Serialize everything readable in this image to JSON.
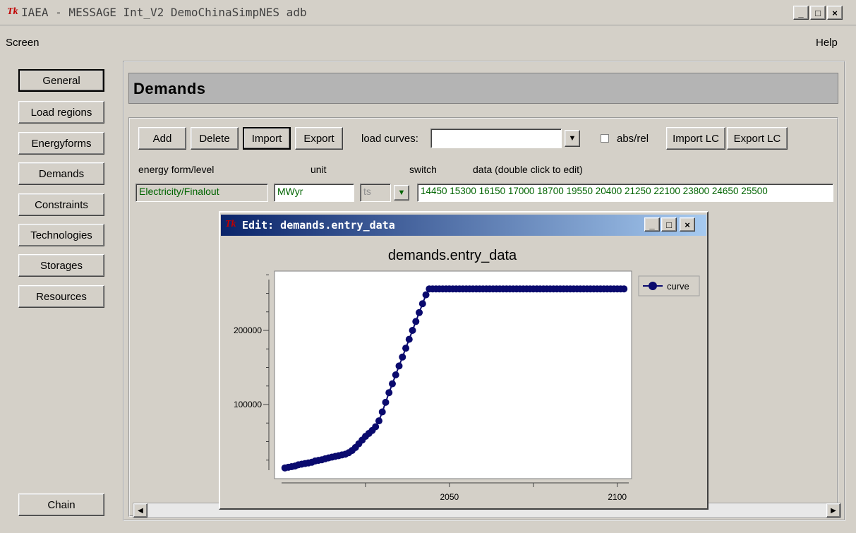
{
  "window": {
    "title": "IAEA - MESSAGE Int_V2 DemoChinaSimpNES adb",
    "logo": "Tk",
    "min": "_",
    "max": "□",
    "close": "×"
  },
  "menu": {
    "screen": "Screen",
    "help": "Help"
  },
  "nav": {
    "general": "General",
    "load_regions": "Load regions",
    "energyforms": "Energyforms",
    "demands": "Demands",
    "constraints": "Constraints",
    "technologies": "Technologies",
    "storages": "Storages",
    "resources": "Resources",
    "chain": "Chain"
  },
  "page": {
    "header": "Demands",
    "toolbar": {
      "add": "Add",
      "delete": "Delete",
      "import": "Import",
      "export": "Export",
      "load_curves_label": "load curves:",
      "load_curves_value": "",
      "absrel_label": "abs/rel",
      "import_lc": "Import LC",
      "export_lc": "Export LC"
    },
    "columns": {
      "energy_form": "energy form/level",
      "unit": "unit",
      "switch": "switch",
      "data": "data (double click to edit)"
    },
    "row": {
      "energy_form": "Electricity/Finalout",
      "unit": "MWyr",
      "switch": "ts",
      "data": "14450 15300 16150 17000 18700 19550 20400 21250 22100 23800 24650 25500"
    }
  },
  "popup": {
    "title": "Edit: demands.entry_data",
    "logo": "Tk",
    "min": "_",
    "max": "□",
    "close": "×"
  },
  "chart_data": {
    "type": "line",
    "title": "demands.entry_data",
    "legend": "curve",
    "legend_placement": "right",
    "marker": "filled-circle",
    "color": "#0a0a6e",
    "xlim": [
      2000,
      2103
    ],
    "ylim": [
      0,
      280000
    ],
    "xticks": [
      2050,
      2100
    ],
    "yticks": [
      100000,
      200000
    ],
    "x": [
      2001,
      2002,
      2003,
      2004,
      2005,
      2006,
      2007,
      2008,
      2009,
      2010,
      2011,
      2012,
      2013,
      2014,
      2015,
      2016,
      2017,
      2018,
      2019,
      2020,
      2021,
      2022,
      2023,
      2024,
      2025,
      2026,
      2027,
      2028,
      2029,
      2030,
      2031,
      2032,
      2033,
      2034,
      2035,
      2036,
      2037,
      2038,
      2039,
      2040,
      2041,
      2042,
      2043,
      2044,
      2045,
      2046,
      2047,
      2048,
      2049,
      2050,
      2051,
      2052,
      2053,
      2054,
      2055,
      2056,
      2057,
      2058,
      2059,
      2060,
      2061,
      2062,
      2063,
      2064,
      2065,
      2066,
      2067,
      2068,
      2069,
      2070,
      2071,
      2072,
      2073,
      2074,
      2075,
      2076,
      2077,
      2078,
      2079,
      2080,
      2081,
      2082,
      2083,
      2084,
      2085,
      2086,
      2087,
      2088,
      2089,
      2090,
      2091,
      2092,
      2093,
      2094,
      2095,
      2096,
      2097,
      2098,
      2099,
      2100,
      2101,
      2102
    ],
    "y": [
      14450,
      15300,
      16150,
      17000,
      18700,
      19550,
      20400,
      21250,
      22100,
      23800,
      24650,
      25500,
      26800,
      28000,
      29000,
      30000,
      31000,
      32000,
      33000,
      35000,
      38000,
      42000,
      47000,
      52000,
      57000,
      61000,
      65000,
      70000,
      78000,
      90000,
      103000,
      116000,
      128000,
      140000,
      152000,
      164000,
      176000,
      188000,
      200000,
      212000,
      224000,
      236000,
      248000,
      256000,
      256000,
      256000,
      256000,
      256000,
      256000,
      256000,
      256000,
      256000,
      256000,
      256000,
      256000,
      256000,
      256000,
      256000,
      256000,
      256000,
      256000,
      256000,
      256000,
      256000,
      256000,
      256000,
      256000,
      256000,
      256000,
      256000,
      256000,
      256000,
      256000,
      256000,
      256000,
      256000,
      256000,
      256000,
      256000,
      256000,
      256000,
      256000,
      256000,
      256000,
      256000,
      256000,
      256000,
      256000,
      256000,
      256000,
      256000,
      256000,
      256000,
      256000,
      256000,
      256000,
      256000,
      256000,
      256000,
      256000,
      256000,
      256000
    ]
  }
}
